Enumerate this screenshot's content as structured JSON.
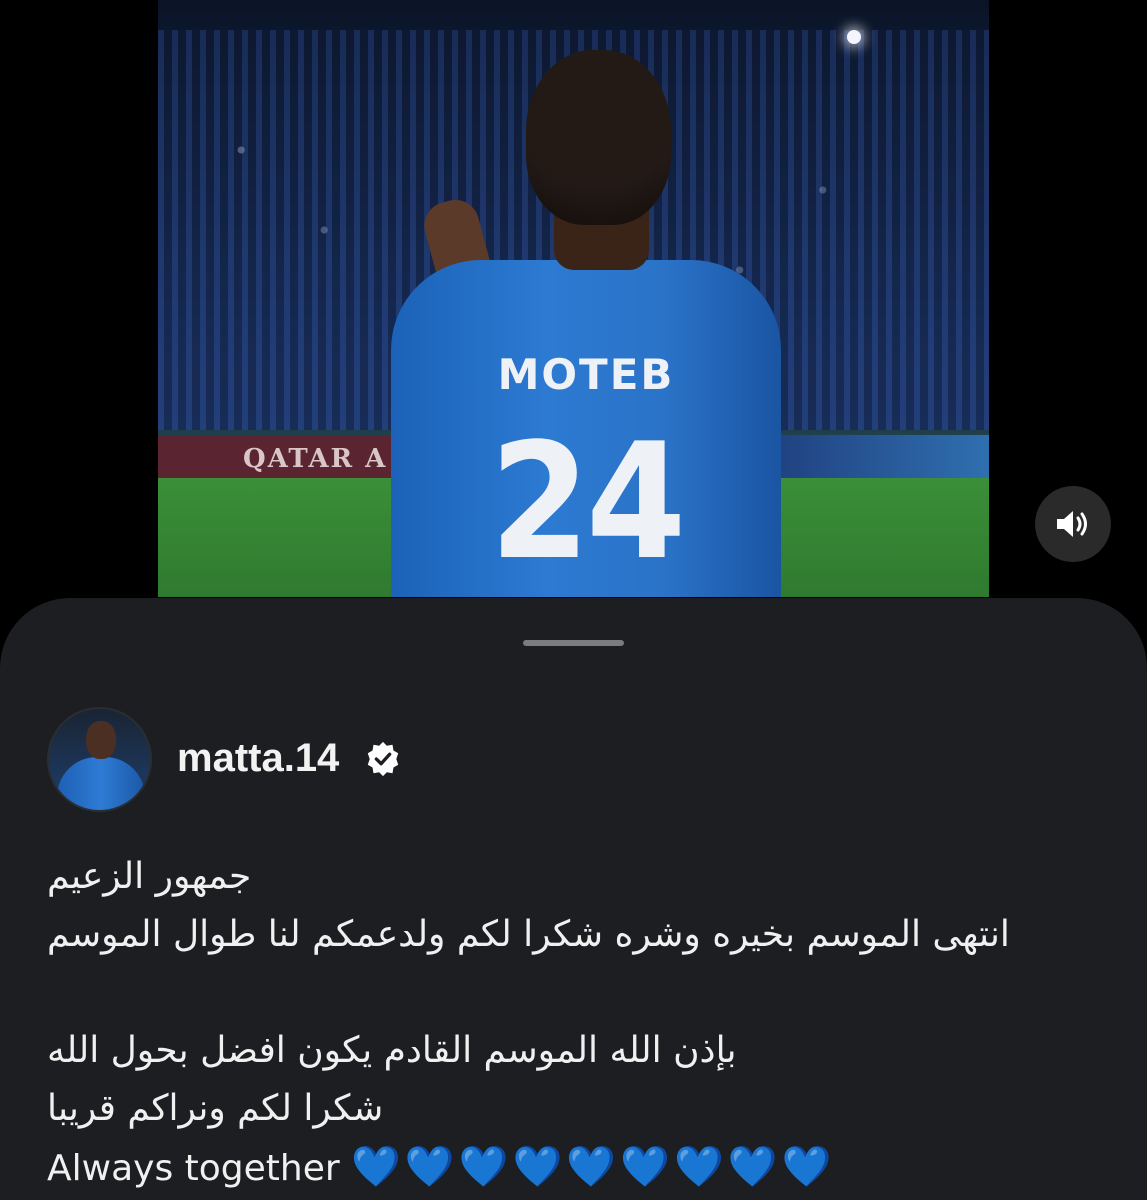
{
  "photo": {
    "jersey_name": "MOTEB",
    "jersey_number": "24",
    "banner_text": "QATAR A"
  },
  "controls": {
    "mute_icon": "speaker-volume-icon"
  },
  "post": {
    "username": "matta.14",
    "verified_icon": "verified-badge-icon",
    "caption": {
      "line1": "جمهور الزعيم",
      "line2": "انتهى الموسم بخيره وشره شكرا لكم ولدعمكم لنا طوال الموسم",
      "line3": "بإذن الله الموسم القادم يكون افضل بحول الله",
      "line4": "شكرا لكم ونراكم قريبا",
      "line5_text": "Always together",
      "line5_hearts": "💙💙💙💙💙💙💙💙💙"
    }
  },
  "colors": {
    "sheet_bg": "#1c1e21",
    "heart_blue": "#3b7cf0"
  }
}
